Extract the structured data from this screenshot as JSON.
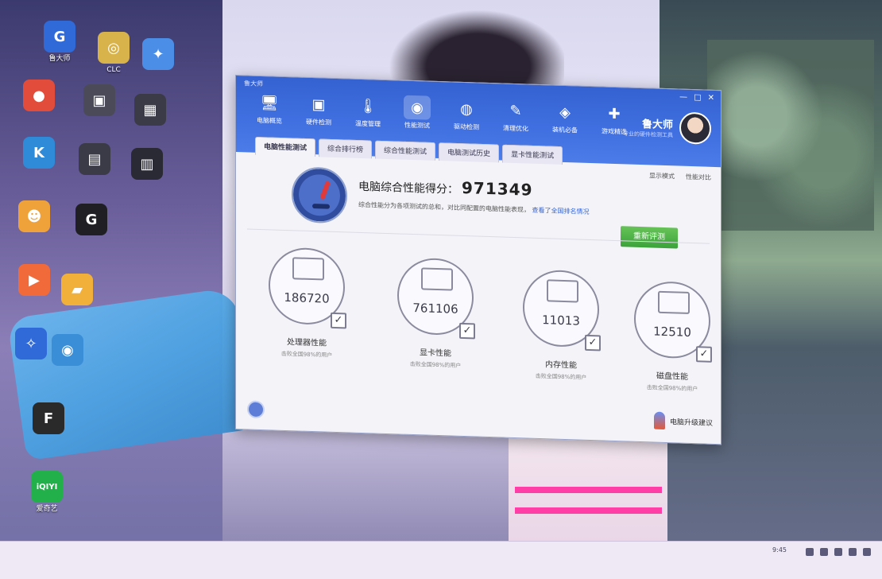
{
  "desktop": {
    "icons": [
      {
        "label": "鲁大师",
        "glyph": "G",
        "color": "#2f6ad8"
      },
      {
        "label": "CLC",
        "glyph": "◎",
        "color": "#d8b24a"
      },
      {
        "label": "",
        "glyph": "✦",
        "color": "#4a8ee8"
      },
      {
        "label": "",
        "glyph": "●",
        "color": "#e14c3b"
      },
      {
        "label": "",
        "glyph": "▣",
        "color": "#4a4a58"
      },
      {
        "label": "",
        "glyph": "▦",
        "color": "#3b3b48"
      },
      {
        "label": "",
        "glyph": "K",
        "color": "#2f8ad8"
      },
      {
        "label": "",
        "glyph": "▤",
        "color": "#3b3b48"
      },
      {
        "label": "",
        "glyph": "▥",
        "color": "#2a2a34"
      },
      {
        "label": "",
        "glyph": "☻",
        "color": "#f0a23a"
      },
      {
        "label": "",
        "glyph": "G",
        "color": "#1f1f24"
      },
      {
        "label": "",
        "glyph": "▶",
        "color": "#f06a3a"
      },
      {
        "label": "",
        "glyph": "▰",
        "color": "#f0b03a"
      },
      {
        "label": "",
        "glyph": "✧",
        "color": "#2f6ad8"
      },
      {
        "label": "",
        "glyph": "◉",
        "color": "#3a8ed8"
      },
      {
        "label": "",
        "glyph": "F",
        "color": "#2a2a2a"
      },
      {
        "label": "爱奇艺",
        "glyph": "iQIYI",
        "color": "#22b04a"
      }
    ]
  },
  "window": {
    "app_title": "鲁大师",
    "controls": [
      "—",
      "□",
      "✕"
    ],
    "nav": [
      {
        "label": "电脑概览",
        "icon": "monitor-icon",
        "glyph": "🖥"
      },
      {
        "label": "硬件检测",
        "icon": "chip-icon",
        "glyph": "▣"
      },
      {
        "label": "温度管理",
        "icon": "thermometer-icon",
        "glyph": "🌡"
      },
      {
        "label": "性能测试",
        "icon": "speedometer-icon",
        "glyph": "◉"
      },
      {
        "label": "驱动检测",
        "icon": "driver-icon",
        "glyph": "◍"
      },
      {
        "label": "清理优化",
        "icon": "broom-icon",
        "glyph": "✎"
      },
      {
        "label": "装机必备",
        "icon": "box-icon",
        "glyph": "◈"
      },
      {
        "label": "游戏精选",
        "icon": "gamepad-icon",
        "glyph": "✚"
      }
    ],
    "user": {
      "name": "鲁大师",
      "subtitle": "专业的硬件检测工具"
    },
    "subtabs": [
      "电脑性能测试",
      "综合排行榜",
      "综合性能测试",
      "电脑测试历史",
      "显卡性能测试"
    ],
    "toolbar": [
      "显示模式",
      "性能对比"
    ],
    "score": {
      "title": "电脑综合性能得分：",
      "value": "971349",
      "description": "综合性能分为各项测试的总和，对比同配置的电脑性能表现，",
      "link": "查看了全国排名情况"
    },
    "rerun_label": "重新评测",
    "components": [
      {
        "name": "处理器性能",
        "value": "186720",
        "sub": "击败全国98%的用户",
        "icon": "cpu-icon"
      },
      {
        "name": "显卡性能",
        "value": "761106",
        "sub": "击败全国98%的用户",
        "icon": "gpu-icon"
      },
      {
        "name": "内存性能",
        "value": "11013",
        "sub": "击败全国98%的用户",
        "icon": "memory-icon"
      },
      {
        "name": "磁盘性能",
        "value": "12510",
        "sub": "击败全国98%的用户",
        "icon": "disk-icon"
      }
    ],
    "footer_link": "电脑升级建议"
  },
  "taskbar": {
    "clock": "9:45"
  }
}
